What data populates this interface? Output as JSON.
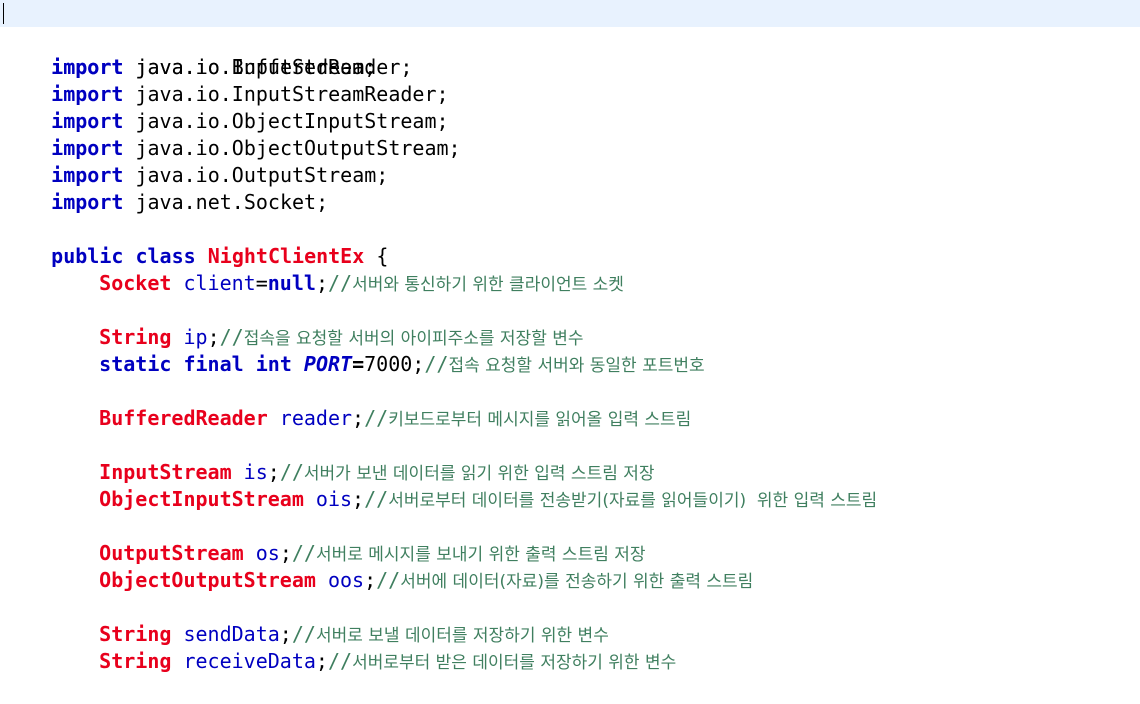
{
  "editor": {
    "imports": [
      {
        "kw": "import",
        "path": "java.io.BufferedReader;"
      },
      {
        "kw": "import",
        "path": "java.io.InputStream;"
      },
      {
        "kw": "import",
        "path": "java.io.InputStreamReader;"
      },
      {
        "kw": "import",
        "path": "java.io.ObjectInputStream;"
      },
      {
        "kw": "import",
        "path": "java.io.ObjectOutputStream;"
      },
      {
        "kw": "import",
        "path": "java.io.OutputStream;"
      },
      {
        "kw": "import",
        "path": "java.net.Socket;"
      }
    ],
    "class_decl": {
      "kw_public": "public",
      "kw_class": "class",
      "name": "NightClientEx",
      "brace": " {"
    },
    "fields": {
      "client": {
        "type": "Socket",
        "name": "client",
        "assign": "=",
        "value": "null",
        "semi": ";",
        "slashes": "//",
        "comment": "서버와 통신하기 위한 클라이언트 소켓"
      },
      "ip": {
        "type": "String",
        "name": "ip",
        "semi": ";",
        "slashes": "//",
        "comment": "접속을 요청할 서버의 아이피주소를 저장할 변수"
      },
      "port": {
        "kw_static": "static",
        "kw_final": "final",
        "kw_int": "int",
        "name": "PORT",
        "assign": "=",
        "value": "7000",
        "semi": ";",
        "slashes": "//",
        "comment": "접속 요청할 서버와 동일한 포트번호"
      },
      "reader": {
        "type": "BufferedReader",
        "name": "reader",
        "semi": ";",
        "slashes": "//",
        "comment": "키보드로부터 메시지를 읽어올 입력 스트림"
      },
      "is": {
        "type": "InputStream",
        "name": "is",
        "semi": ";",
        "slashes": "//",
        "comment": "서버가 보낸 데이터를 읽기 위한 입력 스트림 저장"
      },
      "ois": {
        "type": "ObjectInputStream",
        "name": "ois",
        "semi": ";",
        "slashes": "//",
        "comment": "서버로부터 데이터를 전송받기(자료를 읽어들이기)  위한 입력 스트림"
      },
      "os": {
        "type": "OutputStream",
        "name": "os",
        "semi": ";",
        "slashes": "//",
        "comment": "서버로 메시지를 보내기 위한 출력 스트림 저장"
      },
      "oos": {
        "type": "ObjectOutputStream",
        "name": "oos",
        "semi": ";",
        "slashes": "//",
        "comment": "서버에 데이터(자료)를 전송하기 위한 출력 스트림"
      },
      "sendData": {
        "type": "String",
        "name": "sendData",
        "semi": ";",
        "slashes": "//",
        "comment": "서버로 보낼 데이터를 저장하기 위한 변수"
      },
      "receiveData": {
        "type": "String",
        "name": "receiveData",
        "semi": ";",
        "slashes": "//",
        "comment": "서버로부터 받은 데이터를 저장하기 위한 변수"
      }
    }
  },
  "colors": {
    "keyword": "#0000c0",
    "type": "#e8001c",
    "comment": "#3f7f5f",
    "current_line": "#e8f2fe"
  }
}
